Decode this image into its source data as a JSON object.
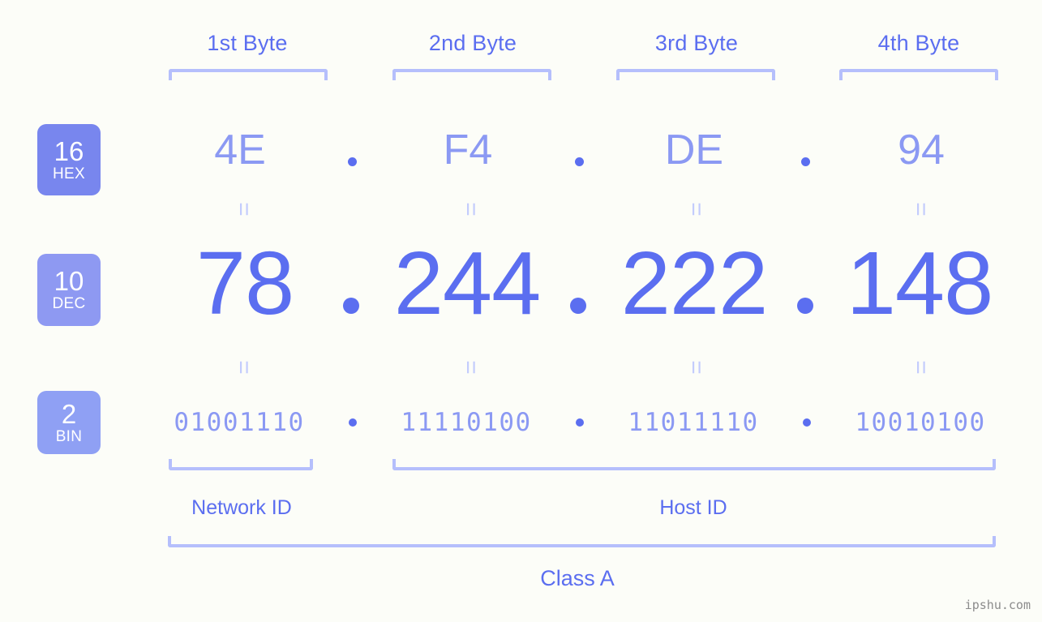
{
  "watermark": "ipshu.com",
  "headers": [
    {
      "label": "1st Byte"
    },
    {
      "label": "2nd Byte"
    },
    {
      "label": "3rd Byte"
    },
    {
      "label": "4th Byte"
    }
  ],
  "bases": {
    "hex": {
      "number": "16",
      "name": "HEX",
      "color": "#7886ee"
    },
    "dec": {
      "number": "10",
      "name": "DEC",
      "color": "#8e99f2"
    },
    "bin": {
      "number": "2",
      "name": "BIN",
      "color": "#8fa0f4"
    }
  },
  "separator": ".",
  "equals": "=",
  "rows": {
    "hex": {
      "octets": [
        "4E",
        "F4",
        "DE",
        "94"
      ]
    },
    "dec": {
      "octets": [
        "78",
        "244",
        "222",
        "148"
      ]
    },
    "bin": {
      "octets": [
        "01001110",
        "11110100",
        "11011110",
        "10010100"
      ]
    }
  },
  "regions": {
    "network_id": "Network ID",
    "host_id": "Host ID",
    "class": "Class A"
  },
  "colors": {
    "background": "#fcfdf8",
    "accent_strong": "#5b6ef0",
    "accent_light": "#8b99f3",
    "bracket": "#b5bffc",
    "equals": "#c3ccfd"
  }
}
